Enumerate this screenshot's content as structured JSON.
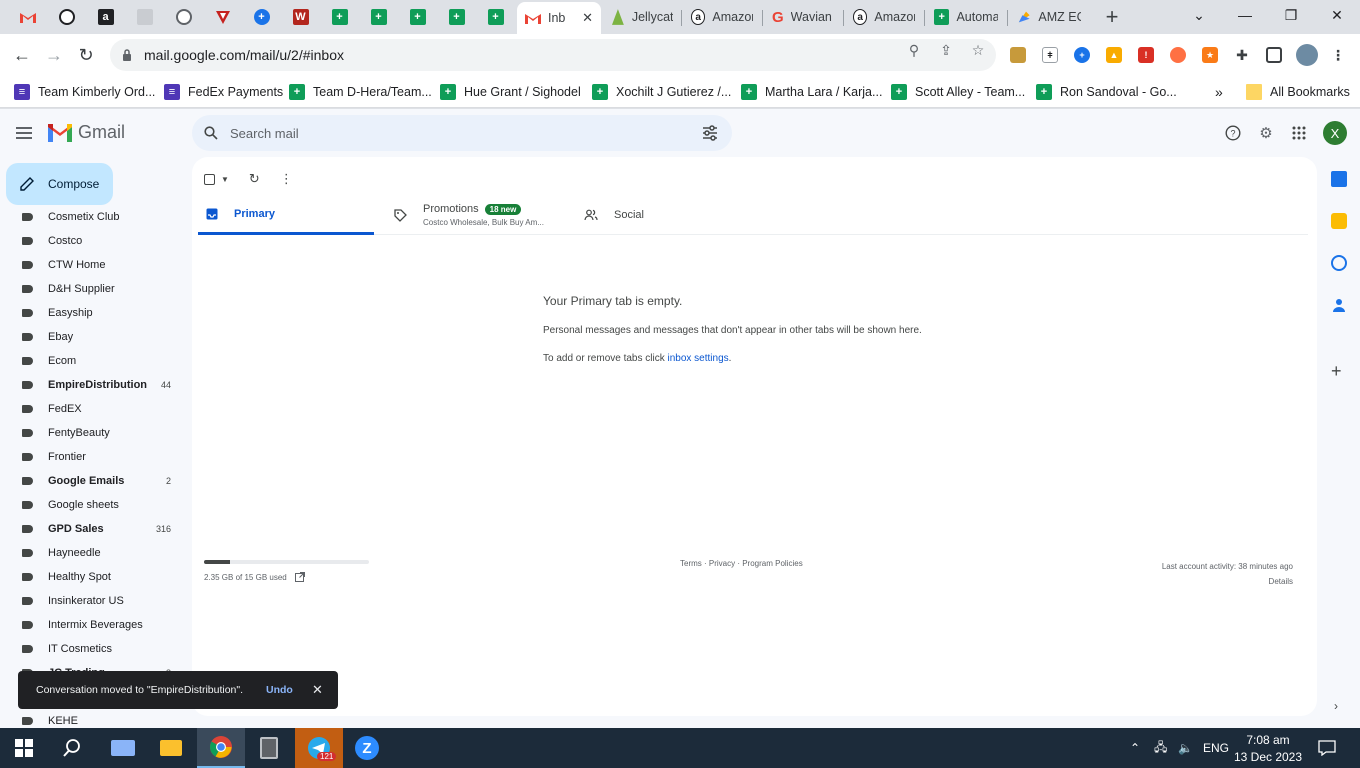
{
  "browser": {
    "tabs": [
      {
        "title": "Inb",
        "active": true
      },
      {
        "title": "Jellycat"
      },
      {
        "title": "Amazon"
      },
      {
        "title": "Wavian"
      },
      {
        "title": "Amazon"
      },
      {
        "title": "Automa"
      },
      {
        "title": "AMZ EC"
      }
    ],
    "url": "mail.google.com/mail/u/2/#inbox",
    "bookmarks": [
      {
        "label": "Team Kimberly Ord..."
      },
      {
        "label": "FedEx Payments"
      },
      {
        "label": "Team D-Hera/Team..."
      },
      {
        "label": "Hue Grant / Sighodel"
      },
      {
        "label": "Xochilt J Gutierez /..."
      },
      {
        "label": "Martha Lara / Karja..."
      },
      {
        "label": "Scott Alley - Team..."
      },
      {
        "label": "Ron Sandoval - Go..."
      }
    ],
    "all_bookmarks": "All Bookmarks",
    "more_bookmarks": "»"
  },
  "gmail": {
    "app_name": "Gmail",
    "search_placeholder": "Search mail",
    "avatar_letter": "X",
    "compose_label": "Compose",
    "labels": [
      {
        "name": "Cosmetix Club",
        "bold": false,
        "count": ""
      },
      {
        "name": "Costco",
        "bold": false,
        "count": ""
      },
      {
        "name": "CTW Home",
        "bold": false,
        "count": ""
      },
      {
        "name": "D&H Supplier",
        "bold": false,
        "count": ""
      },
      {
        "name": "Easyship",
        "bold": false,
        "count": ""
      },
      {
        "name": "Ebay",
        "bold": false,
        "count": ""
      },
      {
        "name": "Ecom",
        "bold": false,
        "count": ""
      },
      {
        "name": "EmpireDistribution",
        "bold": true,
        "count": "44"
      },
      {
        "name": "FedEX",
        "bold": false,
        "count": ""
      },
      {
        "name": "FentyBeauty",
        "bold": false,
        "count": ""
      },
      {
        "name": "Frontier",
        "bold": false,
        "count": ""
      },
      {
        "name": "Google Emails",
        "bold": true,
        "count": "2"
      },
      {
        "name": "Google sheets",
        "bold": false,
        "count": ""
      },
      {
        "name": "GPD Sales",
        "bold": true,
        "count": "316"
      },
      {
        "name": "Hayneedle",
        "bold": false,
        "count": ""
      },
      {
        "name": "Healthy Spot",
        "bold": false,
        "count": ""
      },
      {
        "name": "Insinkerator US",
        "bold": false,
        "count": ""
      },
      {
        "name": "Intermix Beverages",
        "bold": false,
        "count": ""
      },
      {
        "name": "IT Cosmetics",
        "bold": false,
        "count": ""
      },
      {
        "name": "JC Trading",
        "bold": true,
        "count": "8"
      },
      {
        "name": "KEHE",
        "bold": false,
        "count": ""
      }
    ],
    "category_tabs": {
      "primary": "Primary",
      "promotions": "Promotions",
      "promotions_badge": "18 new",
      "promotions_snippet": "Costco Wholesale, Bulk Buy Am...",
      "social": "Social"
    },
    "empty_state": {
      "heading": "Your Primary tab is empty.",
      "body": "Personal messages and messages that don't appear in other tabs will be shown here.",
      "hint_prefix": "To add or remove tabs click",
      "hint_link": "inbox settings",
      "hint_suffix": "."
    },
    "storage": {
      "text": "2.35 GB of 15 GB used",
      "fraction": 0.157
    },
    "footer": {
      "terms": "Terms · Privacy · Program Policies",
      "last_activity": "Last account activity: 38 minutes ago",
      "details": "Details"
    },
    "snackbar": {
      "message": "Conversation moved to \"EmpireDistribution\".",
      "action": "Undo"
    }
  },
  "taskbar": {
    "language": "ENG",
    "time": "7:08 am",
    "date": "13 Dec 2023",
    "telegram_badge": "121"
  }
}
